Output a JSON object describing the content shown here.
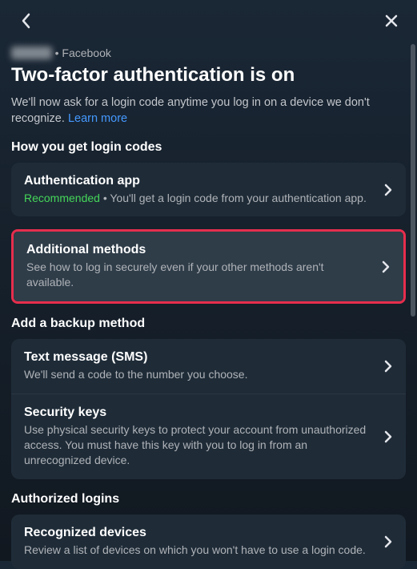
{
  "header": {
    "breadcrumb_account": "Acco nt",
    "breadcrumb_platform": "Facebook",
    "title": "Two-factor authentication is on",
    "subtitle": "We'll now ask for a login code anytime you log in on a device we don't recognize.",
    "learn_more": "Learn more"
  },
  "sections": {
    "login_codes": {
      "heading": "How you get login codes",
      "auth_app": {
        "title": "Authentication app",
        "recommended": "Recommended",
        "desc_suffix": " • You'll get a login code from your authentication app."
      },
      "additional_methods": {
        "title": "Additional methods",
        "desc": "See how to log in securely even if your other methods aren't available."
      }
    },
    "backup": {
      "heading": "Add a backup method",
      "sms": {
        "title": "Text message (SMS)",
        "desc": "We'll send a code to the number you choose."
      },
      "security_keys": {
        "title": "Security keys",
        "desc": "Use physical security keys to protect your account from unauthorized access. You must have this key with you to log in from an unrecognized device."
      }
    },
    "authorized": {
      "heading": "Authorized logins",
      "recognized": {
        "title": "Recognized devices",
        "desc": "Review a list of devices on which you won't have to use a login code."
      }
    }
  }
}
